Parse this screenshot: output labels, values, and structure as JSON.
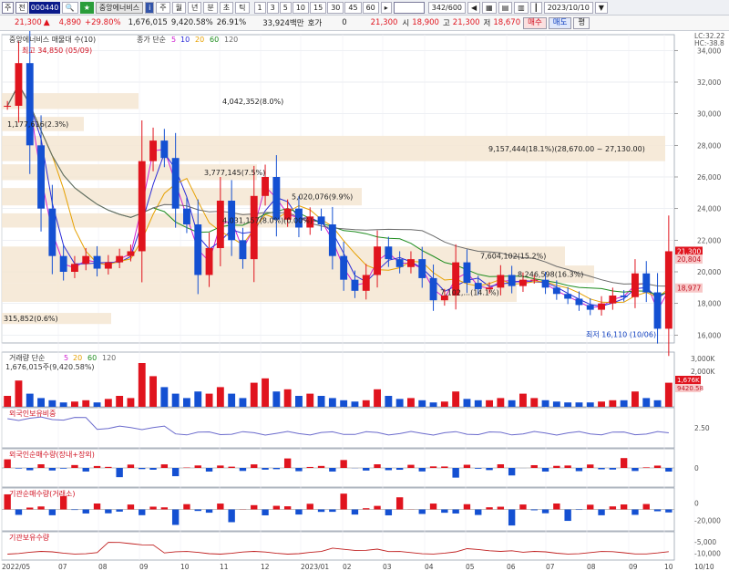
{
  "toolbar1": {
    "market": "주",
    "type": "전",
    "code": "000440",
    "name": "중앙에너비스",
    "period_buttons": [
      "주",
      "월",
      "년",
      "분",
      "초",
      "틱"
    ],
    "intervals": [
      "1",
      "3",
      "5",
      "10",
      "15",
      "30",
      "45",
      "60"
    ],
    "count": "342/600",
    "date": "2023/10/10"
  },
  "toolbar2": {
    "price": "21,300",
    "change": "4,890",
    "change_pct": "+29.80%",
    "volume": "1,676,015",
    "vol_ratio": "9,420.58%",
    "turnover": "26.91%",
    "amount": "33,924백만",
    "quote_label": "호가",
    "quote_value": "0",
    "cur": "21,300",
    "open_label": "시",
    "open": "18,900",
    "high_label": "고",
    "high": "21,300",
    "low_label": "저",
    "low": "18,670",
    "buy": "매수",
    "sell": "매도",
    "more": "평"
  },
  "price_panel": {
    "legend_title": "중앙에너비스 매물대 수(10)",
    "ma_label": "종가 단순",
    "ma_periods": [
      "5",
      "10",
      "20",
      "60",
      "120"
    ],
    "high_label": "최고 34,850 (05/09)",
    "low_label": "최저 16,110 (10/06)",
    "lc_label": "LC:32.22",
    "hc_label": "HC:-38.8",
    "axis": [
      "34,000",
      "32,000",
      "30,000",
      "28,000",
      "26,000",
      "24,000",
      "22,000",
      "20,000",
      "18,000",
      "16,000"
    ],
    "price_tags": [
      "21,300",
      "20,804",
      "18,977"
    ]
  },
  "volume_profile": [
    {
      "label": "4,042,352(8.0%)",
      "range": [
        30300,
        31300
      ]
    },
    {
      "label": "1,177,616(2.3%)",
      "range": [
        28900,
        29800
      ]
    },
    {
      "label": "9,157,444(18.1%)(28,670.00 ~ 27,130.00)",
      "range": [
        27000,
        28600
      ]
    },
    {
      "label": "3,777,145(7.5%)",
      "range": [
        25800,
        26800
      ]
    },
    {
      "label": "5,020,076(9.9%)",
      "range": [
        24200,
        25300
      ]
    },
    {
      "label": "4,031,157(8.0%)(0.00%)",
      "range": [
        22800,
        23700
      ]
    },
    {
      "label": "7,604,102(15.2%)",
      "range": [
        20400,
        21600
      ]
    },
    {
      "label": "8,246,598(16.3%)",
      "range": [
        19300,
        20400
      ]
    },
    {
      "label": "7,102,...(14.1%)",
      "range": [
        18100,
        19300
      ]
    },
    {
      "label": "315,852(0.6%)",
      "range": [
        16700,
        17400
      ]
    }
  ],
  "volume_panel": {
    "title": "거래량 단순",
    "periods": [
      "5",
      "20",
      "60",
      "120"
    ],
    "value": "1,676,015주(9,420.58%)",
    "axis": [
      "3,000K",
      "2,000K"
    ],
    "tags": [
      "1,676K",
      "9420.58"
    ]
  },
  "foreign_panel": {
    "title": "외국인보유비중",
    "axis": [
      "2.50"
    ]
  },
  "foreign_net_panel": {
    "title": "외국인순매수량(장내+장외)",
    "axis": [
      "0"
    ]
  },
  "inst_net_panel": {
    "title": "기관순매수량(거래소)",
    "axis": [
      "0",
      "-20,000"
    ]
  },
  "inst_hold_panel": {
    "title": "기관보유수량",
    "axis": [
      "-5,000",
      "-10,000"
    ]
  },
  "x_axis": [
    "2022/05",
    "07",
    "08",
    "09",
    "10",
    "11",
    "12",
    "2023/01",
    "02",
    "03",
    "04",
    "05",
    "06",
    "07",
    "08",
    "09",
    "10",
    "10/10"
  ],
  "colors": {
    "up": "#e0141e",
    "down": "#1450d2",
    "ma5": "#d020d0",
    "ma10": "#2a2ad8",
    "ma20": "#e6a000",
    "ma60": "#1e8c1e",
    "ma120": "#6a6a6a",
    "profile": "#f5e6d2"
  },
  "chart_data": {
    "type": "candlestick",
    "series_name": "중앙에너비스",
    "ylim": [
      15500,
      35000
    ],
    "points": [
      [
        "2022/05",
        30500
      ],
      [
        "",
        33200
      ],
      [
        "",
        28000
      ],
      [
        "",
        24000
      ],
      [
        "",
        21000
      ],
      [
        "",
        20000
      ],
      [
        "07",
        20500
      ],
      [
        "",
        21000
      ],
      [
        "",
        20200
      ],
      [
        "08",
        20600
      ],
      [
        "",
        21000
      ],
      [
        "",
        21300
      ],
      [
        "",
        27000
      ],
      [
        "09",
        28300
      ],
      [
        "",
        27200
      ],
      [
        "",
        24000
      ],
      [
        "",
        23000
      ],
      [
        "10",
        19800
      ],
      [
        "",
        21500
      ],
      [
        "",
        24500
      ],
      [
        "",
        22000
      ],
      [
        "11",
        20800
      ],
      [
        "",
        24800
      ],
      [
        "",
        26000
      ],
      [
        "",
        23300
      ],
      [
        "12",
        24000
      ],
      [
        "",
        22800
      ],
      [
        "",
        23500
      ],
      [
        "",
        23000
      ],
      [
        "2023/01",
        21000
      ],
      [
        "",
        19500
      ],
      [
        "",
        18800
      ],
      [
        "",
        19800
      ],
      [
        "02",
        21600
      ],
      [
        "",
        20800
      ],
      [
        "",
        20300
      ],
      [
        "",
        20800
      ],
      [
        "03",
        19600
      ],
      [
        "",
        18200
      ],
      [
        "",
        18500
      ],
      [
        "04",
        20600
      ],
      [
        "",
        19300
      ],
      [
        "",
        18900
      ],
      [
        "05",
        19000
      ],
      [
        "",
        19800
      ],
      [
        "",
        19100
      ],
      [
        "06",
        19500
      ],
      [
        "",
        19500
      ],
      [
        "",
        19000
      ],
      [
        "07",
        18600
      ],
      [
        "",
        18300
      ],
      [
        "",
        17900
      ],
      [
        "08",
        17600
      ],
      [
        "",
        18000
      ],
      [
        "",
        18500
      ],
      [
        "09",
        18400
      ],
      [
        "",
        19900
      ],
      [
        "",
        18700
      ],
      [
        "10",
        16400
      ],
      [
        "",
        21300
      ]
    ],
    "volumes": [
      0.25,
      0.6,
      0.3,
      0.2,
      0.15,
      0.1,
      0.12,
      0.15,
      0.1,
      0.18,
      0.25,
      0.2,
      1.0,
      0.7,
      0.45,
      0.3,
      0.2,
      0.35,
      0.3,
      0.45,
      0.3,
      0.2,
      0.55,
      0.65,
      0.35,
      0.4,
      0.25,
      0.3,
      0.25,
      0.2,
      0.15,
      0.12,
      0.15,
      0.4,
      0.25,
      0.18,
      0.2,
      0.15,
      0.1,
      0.12,
      0.35,
      0.18,
      0.15,
      0.15,
      0.2,
      0.15,
      0.3,
      0.2,
      0.15,
      0.12,
      0.1,
      0.1,
      0.1,
      0.12,
      0.15,
      0.15,
      0.35,
      0.2,
      0.15,
      0.55
    ]
  }
}
